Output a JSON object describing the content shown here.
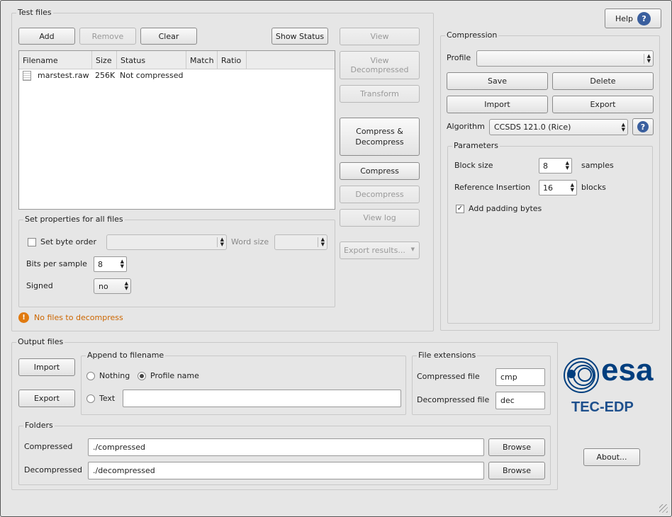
{
  "test_files": {
    "title": "Test files",
    "add": "Add",
    "remove": "Remove",
    "clear": "Clear",
    "show_status": "Show Status",
    "columns": [
      "Filename",
      "Size",
      "Status",
      "Match",
      "Ratio"
    ],
    "rows": [
      {
        "filename": "marstest.raw",
        "size": "256K",
        "status": "Not compressed",
        "match": "",
        "ratio": ""
      }
    ],
    "side_buttons": {
      "view": "View",
      "view_decompressed": "View Decompressed",
      "transform": "Transform",
      "compress_decompress": "Compress & Decompress",
      "compress": "Compress",
      "decompress": "Decompress",
      "view_log": "View log",
      "export_results": "Export results..."
    },
    "set_properties": {
      "title": "Set properties for all files",
      "set_byte_order": "Set byte order",
      "byte_order_value": "",
      "word_size": "Word size",
      "word_size_value": "",
      "bits_per_sample": "Bits per sample",
      "bits_value": "8",
      "signed": "Signed",
      "signed_value": "no"
    },
    "warning": "No files to decompress"
  },
  "help": "Help",
  "compression": {
    "title": "Compression",
    "profile": "Profile",
    "profile_value": "",
    "save": "Save",
    "delete": "Delete",
    "import": "Import",
    "export": "Export",
    "algorithm": "Algorithm",
    "algorithm_value": "CCSDS 121.0 (Rice)",
    "parameters": {
      "title": "Parameters",
      "block_size": "Block size",
      "block_size_value": "8",
      "block_unit": "samples",
      "ref_insertion": "Reference Insertion",
      "ref_value": "16",
      "ref_unit": "blocks",
      "padding": "Add padding bytes",
      "padding_checked": true
    }
  },
  "output": {
    "title": "Output files",
    "import": "Import",
    "export": "Export",
    "append": {
      "title": "Append to filename",
      "nothing": "Nothing",
      "profile_name": "Profile name",
      "text": "Text",
      "text_value": "",
      "selected": "Profile name"
    },
    "extensions": {
      "title": "File extensions",
      "compressed": "Compressed file",
      "compressed_value": "cmp",
      "decompressed": "Decompressed file",
      "decompressed_value": "dec"
    },
    "folders": {
      "title": "Folders",
      "compressed": "Compressed",
      "compressed_value": "./compressed",
      "decompressed": "Decompressed",
      "decompressed_value": "./decompressed",
      "browse": "Browse"
    }
  },
  "logo": {
    "esa": "esa",
    "subtitle": "TEC-EDP",
    "brand_color": "#003e7e"
  },
  "about": "About...",
  "colors": {
    "warning": "#cc6600",
    "background": "#e6e6e6"
  }
}
